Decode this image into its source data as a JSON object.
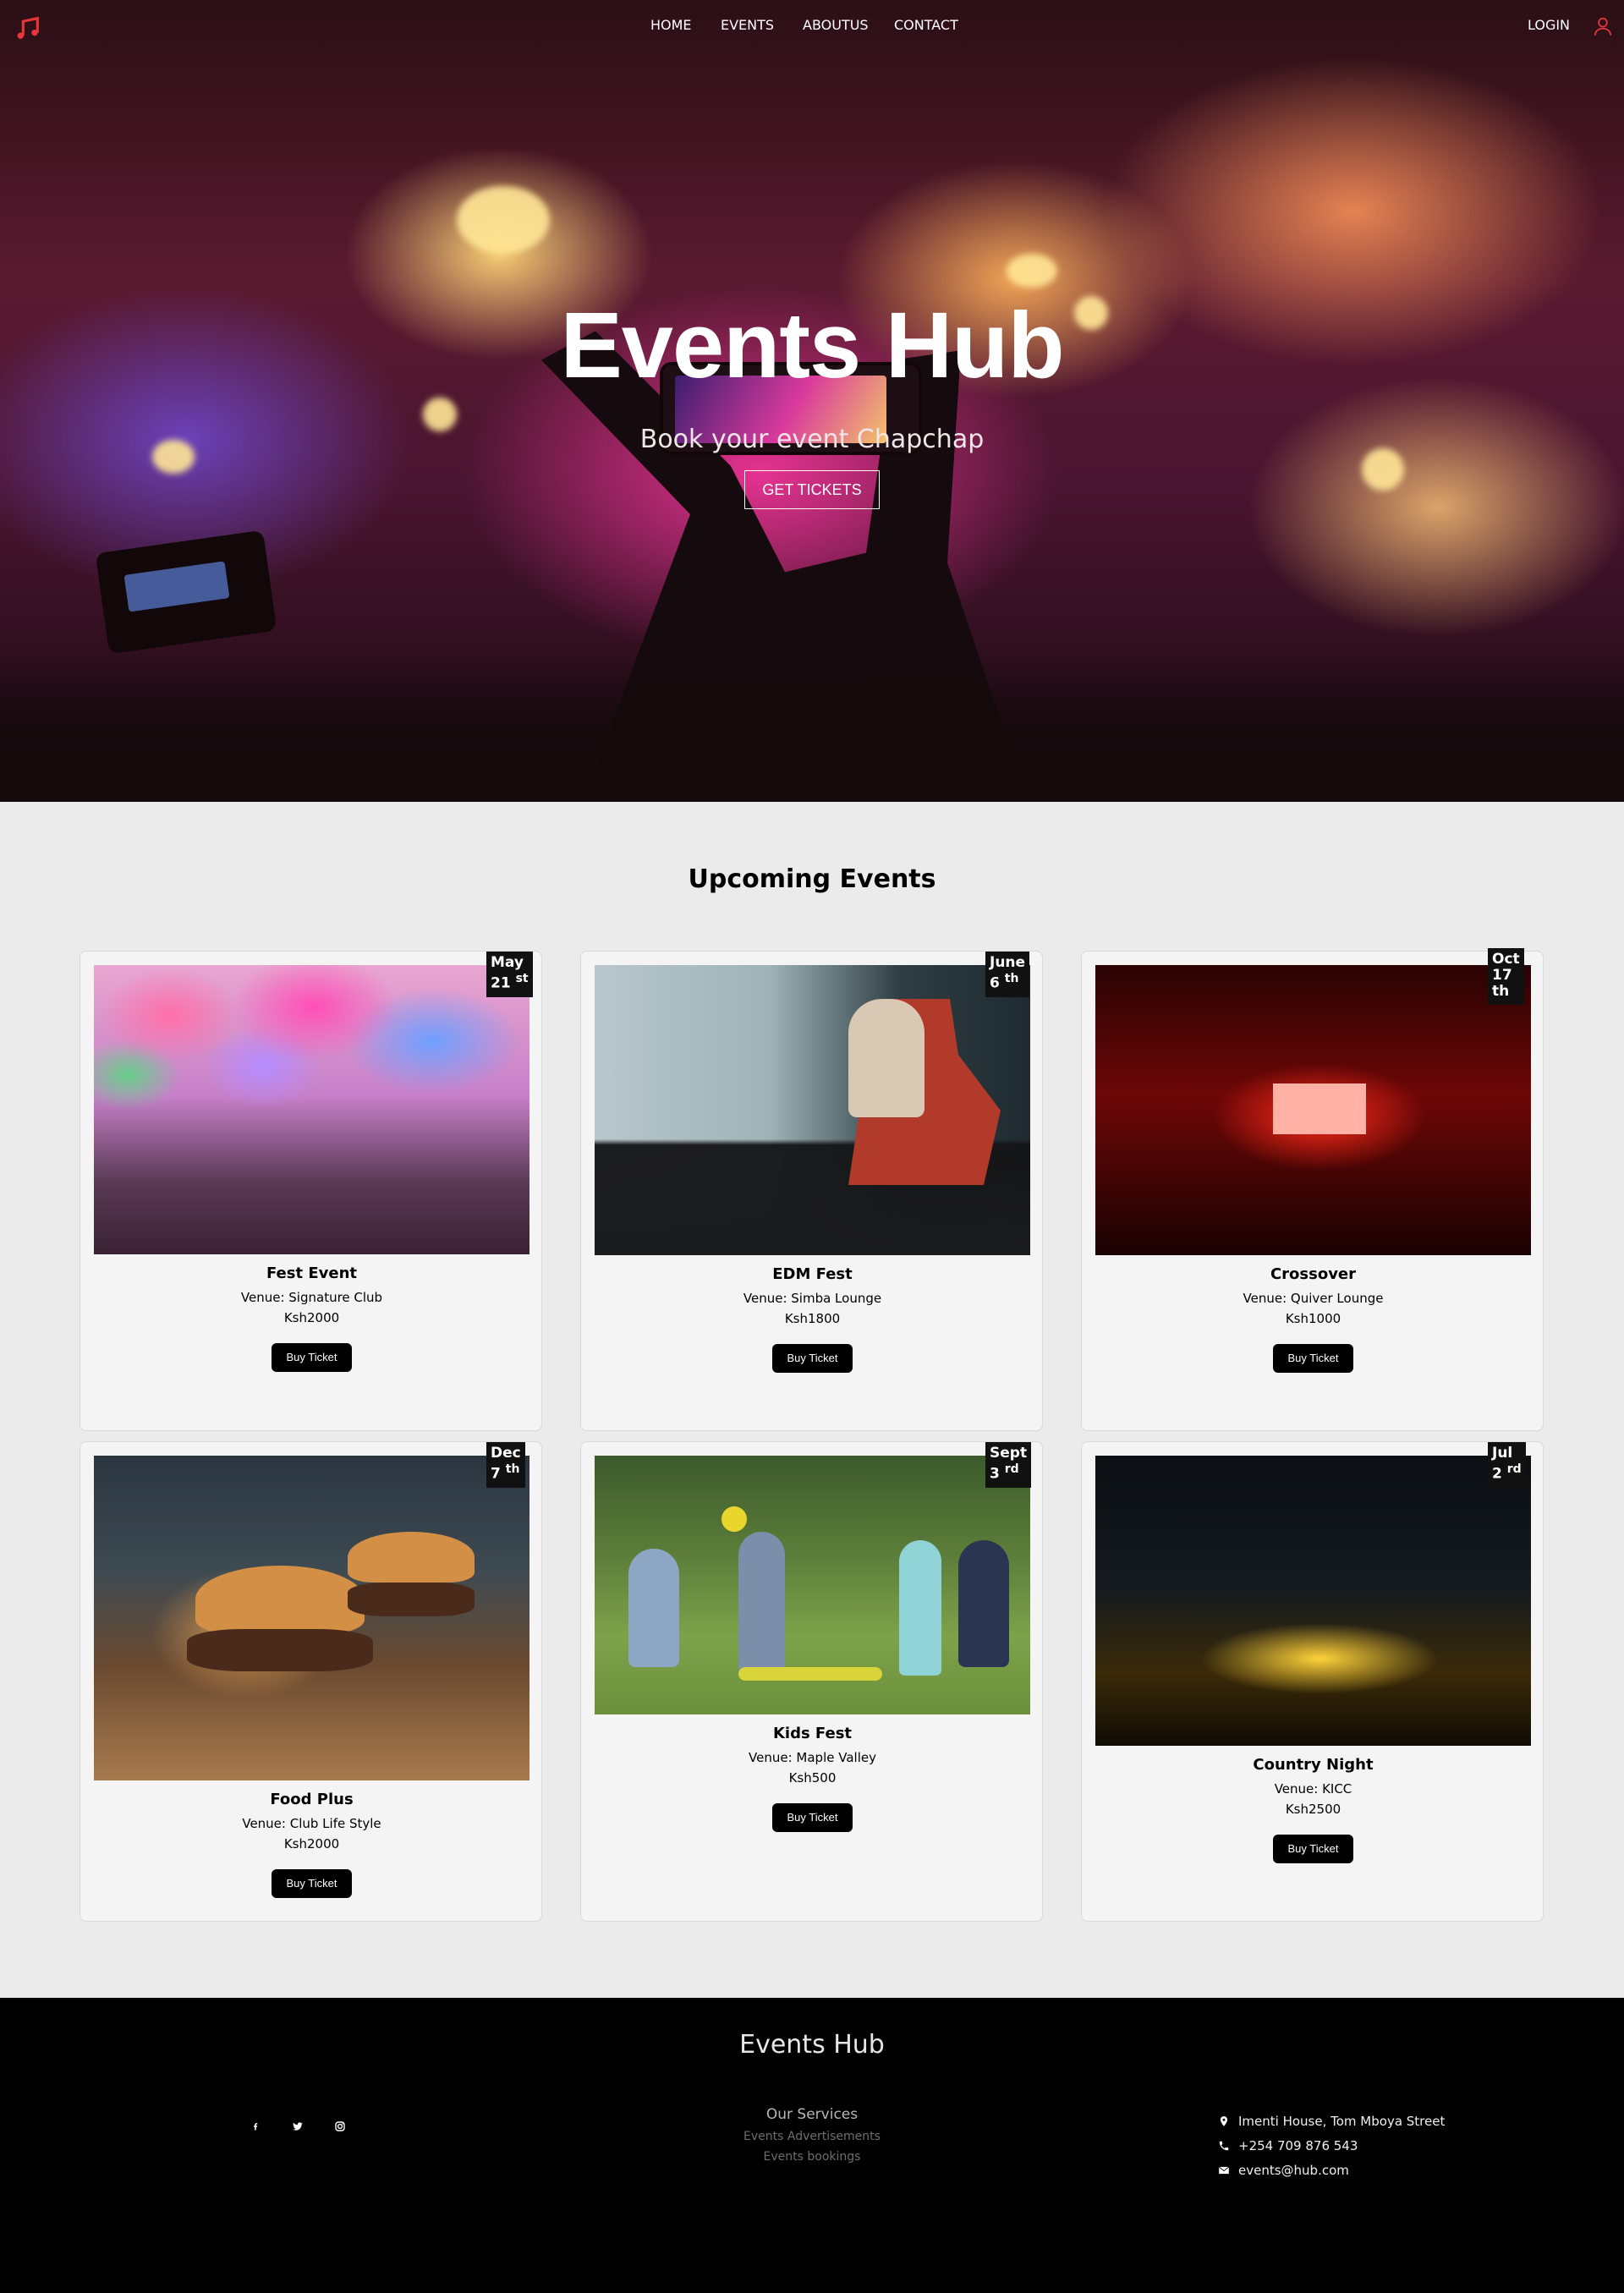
{
  "nav": {
    "links": [
      "HOME",
      "EVENTS",
      "ABOUTUS",
      "CONTACT"
    ],
    "login": "LOGIN"
  },
  "hero": {
    "title": "Events Hub",
    "subtitle": "Book your event Chapchap",
    "cta": "GET TICKETS"
  },
  "events_section": {
    "title": "Upcoming Events",
    "buy_label": "Buy Ticket",
    "events": [
      {
        "name": "Fest Event",
        "venue": "Venue: Signature Club",
        "price": "Ksh2000",
        "date_month": "May",
        "date_day": "21",
        "date_suffix": "st"
      },
      {
        "name": "EDM Fest",
        "venue": "Venue: Simba Lounge",
        "price": "Ksh1800",
        "date_month": "June",
        "date_day": "6",
        "date_suffix": "th"
      },
      {
        "name": "Crossover",
        "venue": "Venue: Quiver Lounge",
        "price": "Ksh1000",
        "date_month": "Oct",
        "date_day": "17",
        "date_suffix": "th"
      },
      {
        "name": "Food Plus",
        "venue": "Venue: Club Life Style",
        "price": "Ksh2000",
        "date_month": "Dec",
        "date_day": "7",
        "date_suffix": "th"
      },
      {
        "name": "Kids Fest",
        "venue": "Venue: Maple Valley",
        "price": "Ksh500",
        "date_month": "Sept",
        "date_day": "3",
        "date_suffix": "rd"
      },
      {
        "name": "Country Night",
        "venue": "Venue: KICC",
        "price": "Ksh2500",
        "date_month": "Jul",
        "date_day": "2",
        "date_suffix": "rd"
      }
    ]
  },
  "footer": {
    "title": "Events Hub",
    "services_title": "Our Services",
    "services": [
      "Events Advertisements",
      "Events bookings"
    ],
    "address": "Imenti House, Tom Mboya Street",
    "phone": "+254 709 876 543",
    "email": "events@hub.com",
    "social_icons": [
      "facebook-icon",
      "twitter-icon",
      "instagram-icon"
    ]
  },
  "colors": {
    "accent": "#e8363a",
    "footer_bg": "#000000",
    "section_bg": "#ebebeb",
    "button_bg": "#000000"
  }
}
